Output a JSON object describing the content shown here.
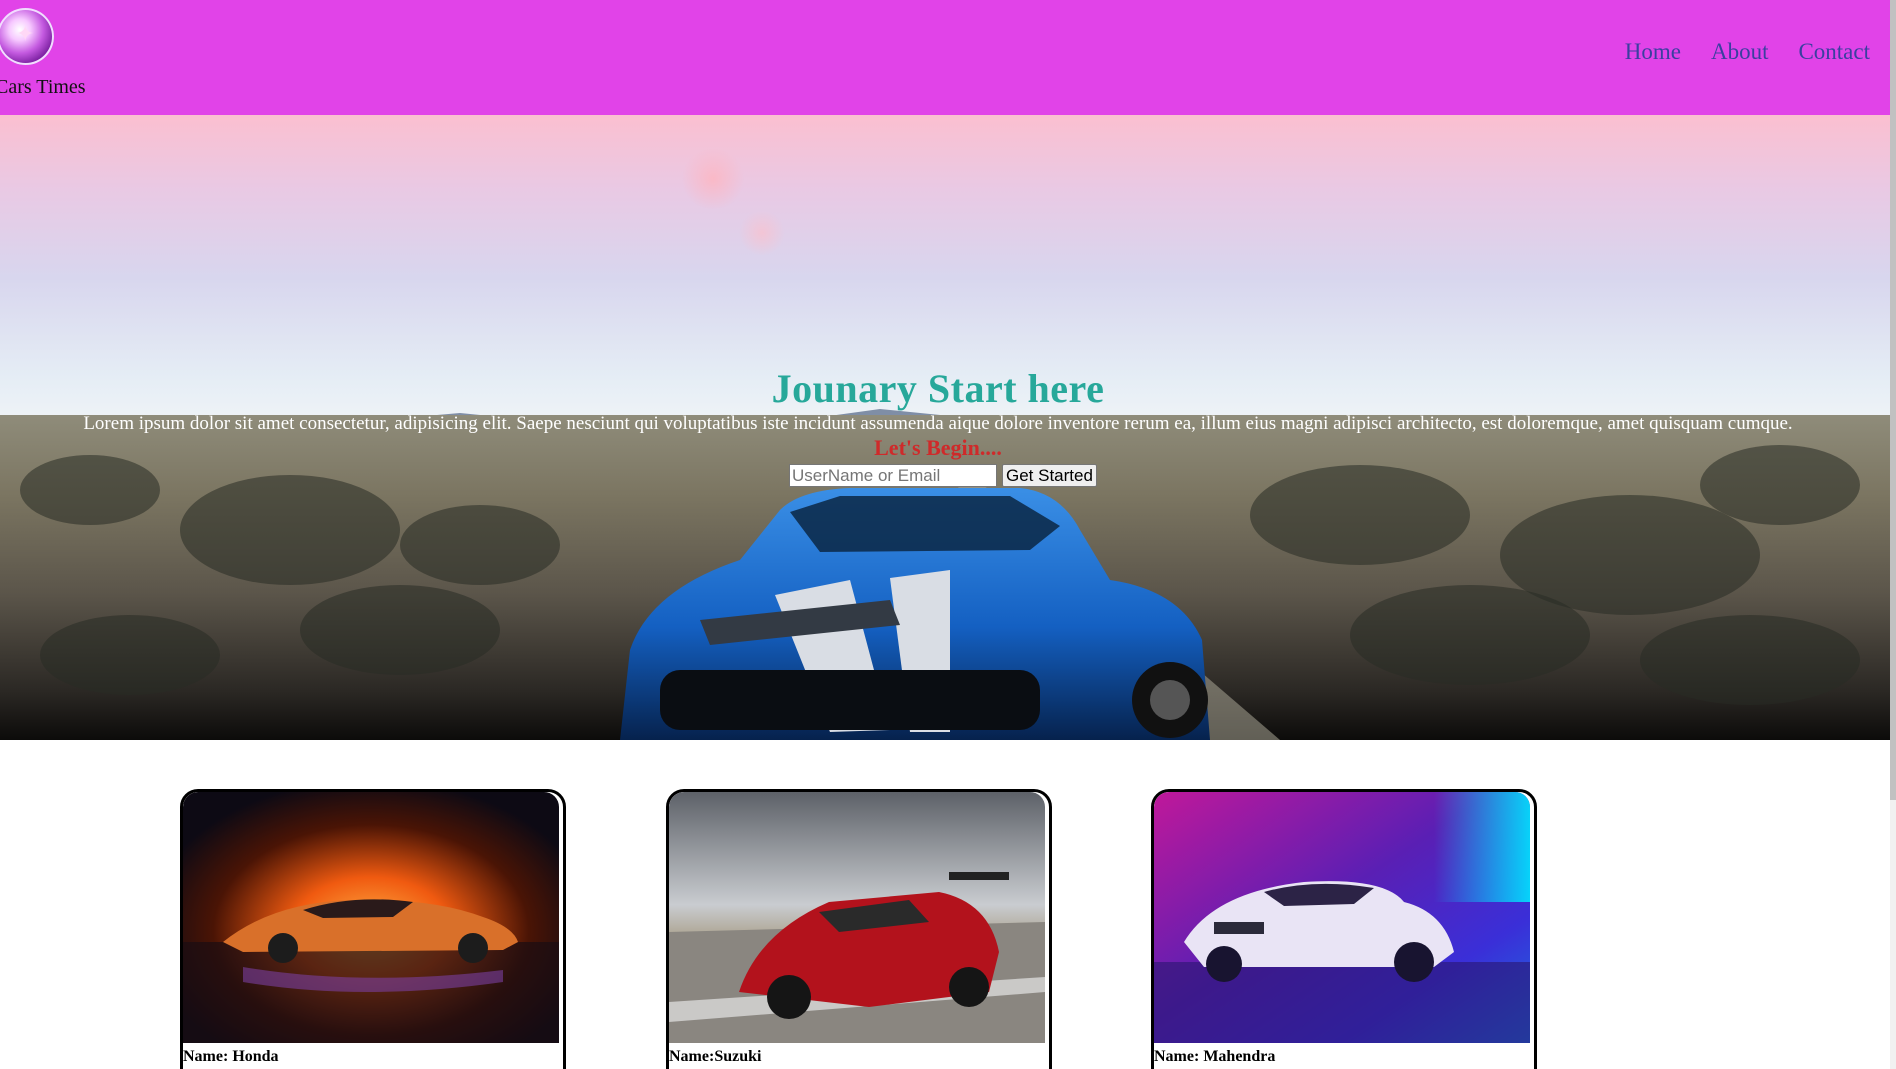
{
  "header": {
    "brand": "Cars Times",
    "logo_icon": "compass-orb-icon",
    "nav": [
      "Home",
      "About",
      "Contact"
    ],
    "background": "#e143e8",
    "nav_color": "#3b3fa0"
  },
  "hero": {
    "title": "Jounary Start here",
    "text": "Lorem ipsum dolor sit amet consectetur, adipisicing elit. Saepe nesciunt qui voluptatibus iste incidunt assumenda aique dolore inventore rerum ea, illum eius magni adipisci architecto, est doloremque, amet quisquam cumque.",
    "subtitle": "Let's Begin....",
    "input_placeholder": "UserName or Email",
    "button_label": "Get Started",
    "title_color": "#27a89a",
    "subtitle_color": "#cf2a2a"
  },
  "cards": [
    {
      "name": "Name: Honda"
    },
    {
      "name": "Name:Suzuki"
    },
    {
      "name": "Name: Mahendra"
    }
  ]
}
